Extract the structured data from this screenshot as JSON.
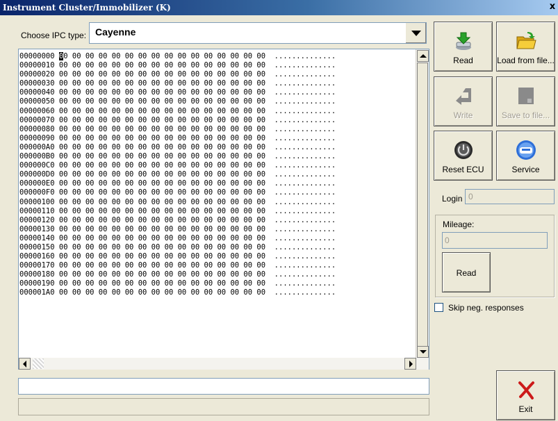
{
  "window": {
    "title": "Instrument Cluster/Immobilizer (K)",
    "close_glyph": "x"
  },
  "ipc": {
    "label": "Choose IPC type:",
    "selected": "Cayenne"
  },
  "hex": {
    "rows": [
      {
        "addr": "00000000",
        "bytes": "00 00 00 00 00 00 00 00 00 00 00 00 00 00 00 00",
        "ascii": ".............."
      },
      {
        "addr": "00000010",
        "bytes": "00 00 00 00 00 00 00 00 00 00 00 00 00 00 00 00",
        "ascii": ".............."
      },
      {
        "addr": "00000020",
        "bytes": "00 00 00 00 00 00 00 00 00 00 00 00 00 00 00 00",
        "ascii": ".............."
      },
      {
        "addr": "00000030",
        "bytes": "00 00 00 00 00 00 00 00 00 00 00 00 00 00 00 00",
        "ascii": ".............."
      },
      {
        "addr": "00000040",
        "bytes": "00 00 00 00 00 00 00 00 00 00 00 00 00 00 00 00",
        "ascii": ".............."
      },
      {
        "addr": "00000050",
        "bytes": "00 00 00 00 00 00 00 00 00 00 00 00 00 00 00 00",
        "ascii": ".............."
      },
      {
        "addr": "00000060",
        "bytes": "00 00 00 00 00 00 00 00 00 00 00 00 00 00 00 00",
        "ascii": ".............."
      },
      {
        "addr": "00000070",
        "bytes": "00 00 00 00 00 00 00 00 00 00 00 00 00 00 00 00",
        "ascii": ".............."
      },
      {
        "addr": "00000080",
        "bytes": "00 00 00 00 00 00 00 00 00 00 00 00 00 00 00 00",
        "ascii": ".............."
      },
      {
        "addr": "00000090",
        "bytes": "00 00 00 00 00 00 00 00 00 00 00 00 00 00 00 00",
        "ascii": ".............."
      },
      {
        "addr": "000000A0",
        "bytes": "00 00 00 00 00 00 00 00 00 00 00 00 00 00 00 00",
        "ascii": ".............."
      },
      {
        "addr": "000000B0",
        "bytes": "00 00 00 00 00 00 00 00 00 00 00 00 00 00 00 00",
        "ascii": ".............."
      },
      {
        "addr": "000000C0",
        "bytes": "00 00 00 00 00 00 00 00 00 00 00 00 00 00 00 00",
        "ascii": ".............."
      },
      {
        "addr": "000000D0",
        "bytes": "00 00 00 00 00 00 00 00 00 00 00 00 00 00 00 00",
        "ascii": ".............."
      },
      {
        "addr": "000000E0",
        "bytes": "00 00 00 00 00 00 00 00 00 00 00 00 00 00 00 00",
        "ascii": ".............."
      },
      {
        "addr": "000000F0",
        "bytes": "00 00 00 00 00 00 00 00 00 00 00 00 00 00 00 00",
        "ascii": ".............."
      },
      {
        "addr": "00000100",
        "bytes": "00 00 00 00 00 00 00 00 00 00 00 00 00 00 00 00",
        "ascii": ".............."
      },
      {
        "addr": "00000110",
        "bytes": "00 00 00 00 00 00 00 00 00 00 00 00 00 00 00 00",
        "ascii": ".............."
      },
      {
        "addr": "00000120",
        "bytes": "00 00 00 00 00 00 00 00 00 00 00 00 00 00 00 00",
        "ascii": ".............."
      },
      {
        "addr": "00000130",
        "bytes": "00 00 00 00 00 00 00 00 00 00 00 00 00 00 00 00",
        "ascii": ".............."
      },
      {
        "addr": "00000140",
        "bytes": "00 00 00 00 00 00 00 00 00 00 00 00 00 00 00 00",
        "ascii": ".............."
      },
      {
        "addr": "00000150",
        "bytes": "00 00 00 00 00 00 00 00 00 00 00 00 00 00 00 00",
        "ascii": ".............."
      },
      {
        "addr": "00000160",
        "bytes": "00 00 00 00 00 00 00 00 00 00 00 00 00 00 00 00",
        "ascii": ".............."
      },
      {
        "addr": "00000170",
        "bytes": "00 00 00 00 00 00 00 00 00 00 00 00 00 00 00 00",
        "ascii": ".............."
      },
      {
        "addr": "00000180",
        "bytes": "00 00 00 00 00 00 00 00 00 00 00 00 00 00 00 00",
        "ascii": ".............."
      },
      {
        "addr": "00000190",
        "bytes": "00 00 00 00 00 00 00 00 00 00 00 00 00 00 00 00",
        "ascii": ".............."
      },
      {
        "addr": "000001A0",
        "bytes": "00 00 00 00 00 00 00 00 00 00 00 00 00 00 00 00",
        "ascii": ".............."
      }
    ]
  },
  "buttons": {
    "read": "Read",
    "load": "Load from file...",
    "write": "Write",
    "save": "Save to file...",
    "reset": "Reset ECU",
    "service": "Service",
    "exit": "Exit"
  },
  "login": {
    "label": "Login",
    "value": "0"
  },
  "mileage": {
    "label": "Mileage:",
    "value": "0",
    "read_label": "Read"
  },
  "skip": {
    "label": "Skip neg. responses",
    "checked": false
  },
  "icons": {
    "read": "download-arrow-icon",
    "load": "open-folder-icon",
    "write": "upload-arrow-icon",
    "save": "floppy-disk-icon",
    "reset": "power-icon",
    "service": "car-service-icon",
    "exit": "red-x-icon"
  },
  "colors": {
    "title_bar_start": "#0a246a",
    "title_bar_end": "#a6caf0",
    "window_bg": "#ece9d8",
    "exit_icon": "#cc1a1a",
    "read_icon": "#2aa12a",
    "folder_icon": "#f0c020",
    "service_icon": "#2e6fd8"
  }
}
